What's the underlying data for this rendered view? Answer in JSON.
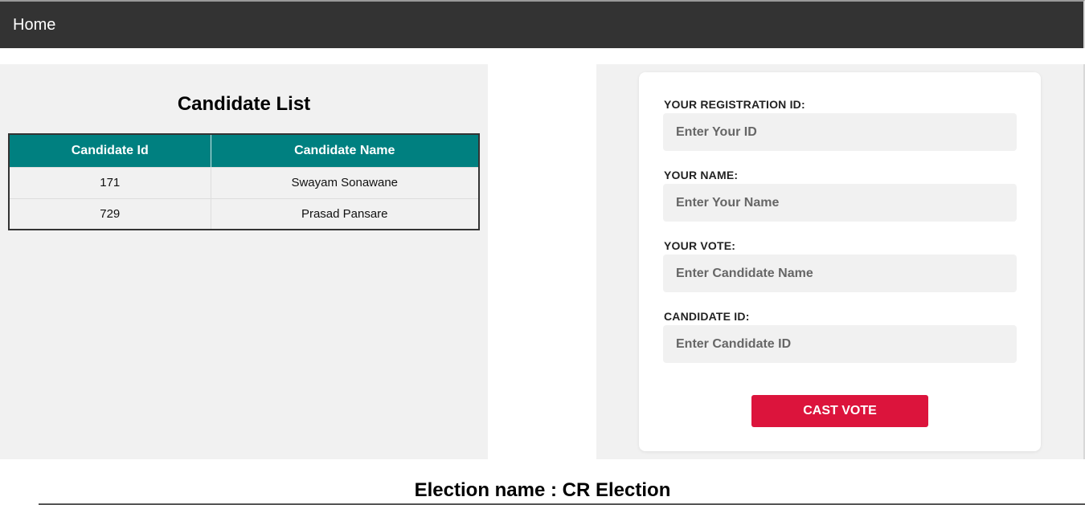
{
  "nav": {
    "home_label": "Home"
  },
  "candidate_list": {
    "title": "Candidate List",
    "columns": [
      "Candidate Id",
      "Candidate Name"
    ],
    "rows": [
      {
        "id": "171",
        "name": "Swayam Sonawane"
      },
      {
        "id": "729",
        "name": "Prasad Pansare"
      }
    ]
  },
  "vote_form": {
    "registration_id": {
      "label": "YOUR REGISTRATION ID:",
      "placeholder": "Enter Your ID",
      "value": ""
    },
    "name": {
      "label": "YOUR NAME:",
      "placeholder": "Enter Your Name",
      "value": ""
    },
    "vote": {
      "label": "YOUR VOTE:",
      "placeholder": "Enter Candidate Name",
      "value": ""
    },
    "candidate_id": {
      "label": "CANDIDATE ID:",
      "placeholder": "Enter Candidate ID",
      "value": ""
    },
    "submit_label": "CAST VOTE"
  },
  "footer": {
    "election_name": "Election name : CR Election"
  },
  "colors": {
    "nav_bg": "#333333",
    "table_header": "#008080",
    "button": "#dc143c",
    "panel_bg": "#f1f1f1"
  }
}
